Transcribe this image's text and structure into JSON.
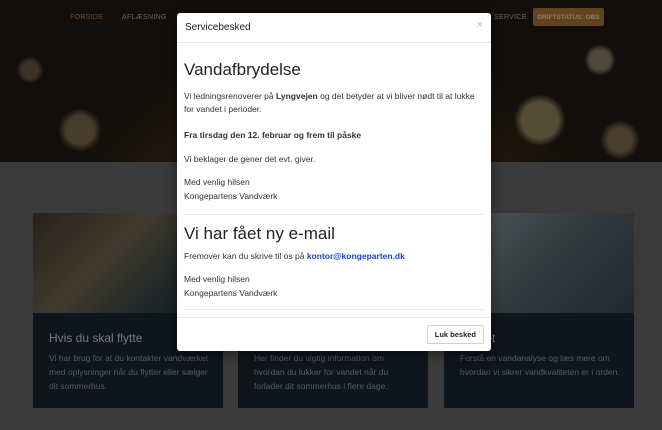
{
  "nav": {
    "forside": "FORSIDE",
    "aflaesning": "AFLÆSNING",
    "service": "SERVICE",
    "driftstatus": "DRIFTSTATUS: OBS"
  },
  "cards": [
    {
      "title": "Hvis du skal flytte",
      "text": "Vi har brug for at du kontakter vandværket med oplysninger når du flytter eller sælger dit sommerhus."
    },
    {
      "title": "",
      "text": "Her finder du vigtig information om hvordan du lukker for vandet når du forlader dit sommerhus i flere dage."
    },
    {
      "title": "kvalitet",
      "text": "Forstå en vandanalyse og læs mere om hvordan vi sikrer vandkvaliteten er i orden."
    }
  ],
  "modal": {
    "title": "Servicebesked",
    "close_symbol": "×",
    "section1": {
      "heading": "Vandafbrydelse",
      "p1_before": "Vi ledningsrenoverer på ",
      "p1_bold": "Lyngvejen",
      "p1_after": " og det betyder at vi bliver nødt til at lukke for vandet i perioder.",
      "p2": "Fra tirsdag den 12. februar og frem til påske",
      "p3": "Vi beklager de gener det evt. giver.",
      "greeting": "Med venlig hilsen",
      "signature": "Kongepartens Vandværk"
    },
    "section2": {
      "heading": "Vi har fået ny e-mail",
      "p1_before": "Fremover kan du skrive til os på ",
      "email": "kontor@kongeparten.dk",
      "greeting": "Med venlig hilsen",
      "signature": "Kongepartens Vandværk"
    },
    "close_button": "Luk besked"
  }
}
